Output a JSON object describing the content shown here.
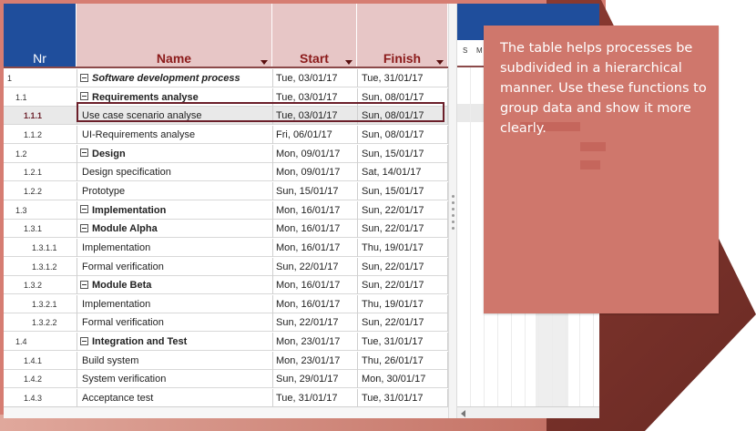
{
  "table": {
    "columns": {
      "nr": "Nr",
      "name": "Name",
      "start": "Start",
      "finish": "Finish"
    },
    "rows": [
      {
        "nr": "1",
        "name": "Software development process",
        "start": "Tue, 03/01/17",
        "finish": "Tue, 31/01/17"
      },
      {
        "nr": "1.1",
        "name": "Requirements analyse",
        "start": "Tue, 03/01/17",
        "finish": "Sun, 08/01/17"
      },
      {
        "nr": "1.1.1",
        "name": "Use case scenario analyse",
        "start": "Tue, 03/01/17",
        "finish": "Sun, 08/01/17"
      },
      {
        "nr": "1.1.2",
        "name": "UI-Requirements analyse",
        "start": "Fri, 06/01/17",
        "finish": "Sun, 08/01/17"
      },
      {
        "nr": "1.2",
        "name": "Design",
        "start": "Mon, 09/01/17",
        "finish": "Sun, 15/01/17"
      },
      {
        "nr": "1.2.1",
        "name": "Design specification",
        "start": "Mon, 09/01/17",
        "finish": "Sat, 14/01/17"
      },
      {
        "nr": "1.2.2",
        "name": "Prototype",
        "start": "Sun, 15/01/17",
        "finish": "Sun, 15/01/17"
      },
      {
        "nr": "1.3",
        "name": "Implementation",
        "start": "Mon, 16/01/17",
        "finish": "Sun, 22/01/17"
      },
      {
        "nr": "1.3.1",
        "name": "Module Alpha",
        "start": "Mon, 16/01/17",
        "finish": "Sun, 22/01/17"
      },
      {
        "nr": "1.3.1.1",
        "name": "Implementation",
        "start": "Mon, 16/01/17",
        "finish": "Thu, 19/01/17"
      },
      {
        "nr": "1.3.1.2",
        "name": "Formal verification",
        "start": "Sun, 22/01/17",
        "finish": "Sun, 22/01/17"
      },
      {
        "nr": "1.3.2",
        "name": "Module Beta",
        "start": "Mon, 16/01/17",
        "finish": "Sun, 22/01/17"
      },
      {
        "nr": "1.3.2.1",
        "name": "Implementation",
        "start": "Mon, 16/01/17",
        "finish": "Thu, 19/01/17"
      },
      {
        "nr": "1.3.2.2",
        "name": "Formal verification",
        "start": "Sun, 22/01/17",
        "finish": "Sun, 22/01/17"
      },
      {
        "nr": "1.4",
        "name": "Integration and Test",
        "start": "Mon, 23/01/17",
        "finish": "Tue, 31/01/17"
      },
      {
        "nr": "1.4.1",
        "name": "Build system",
        "start": "Mon, 23/01/17",
        "finish": "Thu, 26/01/17"
      },
      {
        "nr": "1.4.2",
        "name": "System verification",
        "start": "Sun, 29/01/17",
        "finish": "Mon, 30/01/17"
      },
      {
        "nr": "1.4.3",
        "name": "Acceptance test",
        "start": "Tue, 31/01/17",
        "finish": "Tue, 31/01/17"
      }
    ]
  },
  "gantt": {
    "days": [
      "S",
      "M"
    ]
  },
  "callout": {
    "text": "The table helps processes be subdivided in a hierarchical manner. Use these functions to group data and show it more clearly."
  },
  "colors": {
    "header_blue": "#1f4e9c",
    "header_pink": "#e7c6c6",
    "accent_red": "#8b1a1a",
    "callout": "#cf776c",
    "frame": "#d67d72"
  }
}
